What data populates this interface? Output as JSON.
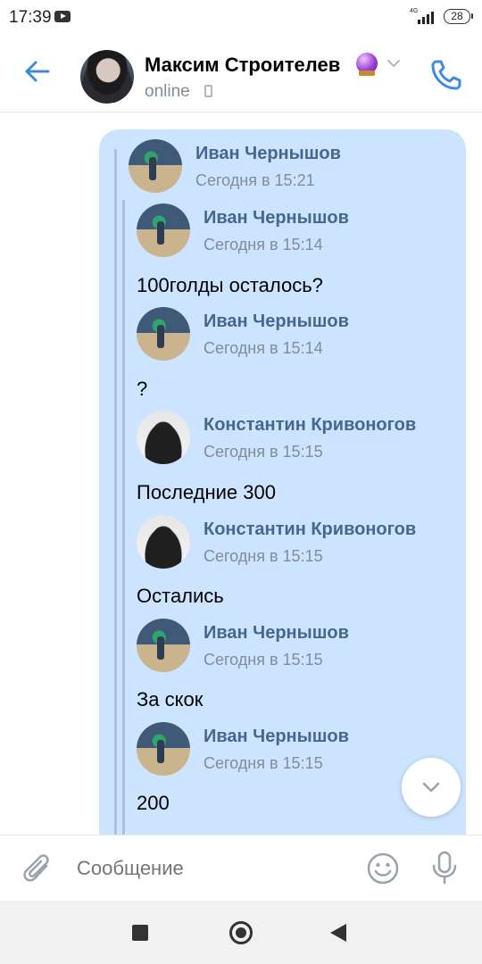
{
  "status_bar": {
    "time": "17:39",
    "network": "4G",
    "battery": "28"
  },
  "header": {
    "contact_name": "Максим Строителев",
    "status": "online"
  },
  "thread": {
    "outer_author": "Иван Чернышов",
    "outer_date": "Сегодня в 15:21",
    "items": [
      {
        "author": "Иван Чернышов",
        "date": "Сегодня в 15:14",
        "text": "100голды осталось?"
      },
      {
        "author": "Иван Чернышов",
        "date": "Сегодня в 15:14",
        "text": "?"
      },
      {
        "author": "Константин Кривоногов",
        "date": "Сегодня в 15:15",
        "text": "Последние 300"
      },
      {
        "author": "Константин Кривоногов",
        "date": "Сегодня в 15:15",
        "text": "Остались"
      },
      {
        "author": "Иван Чернышов",
        "date": "Сегодня в 15:15",
        "text": "За скок"
      },
      {
        "author": "Иван Чернышов",
        "date": "Сегодня в 15:15",
        "text": "200"
      }
    ]
  },
  "composer": {
    "placeholder": "Сообщение"
  },
  "colors": {
    "accent": "#3f8ae0",
    "bubble": "#cce4ff",
    "author_name": "#45678f",
    "secondary_text": "#818c99"
  }
}
